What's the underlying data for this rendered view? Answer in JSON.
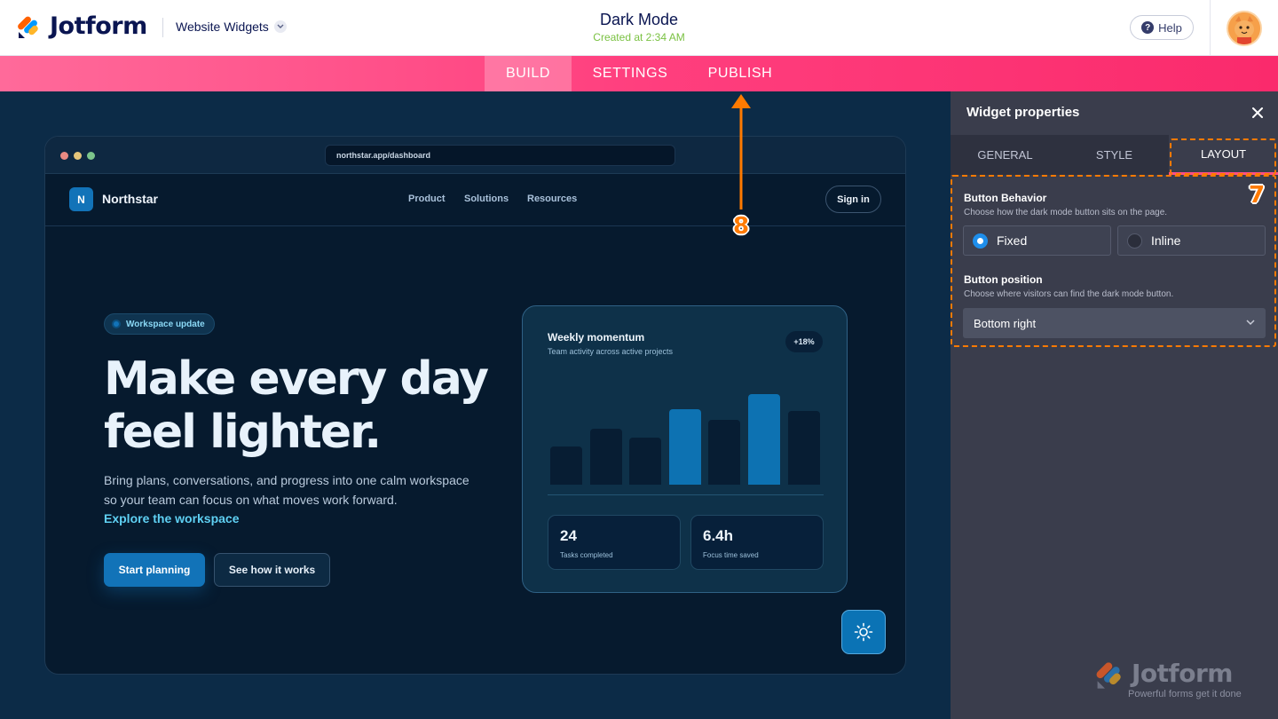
{
  "header": {
    "logo_text": "Jotform",
    "workspace_dropdown": "Website Widgets",
    "doc_title": "Dark Mode",
    "doc_subtitle": "Created at 2:34 AM",
    "help_label": "Help"
  },
  "nav": {
    "tabs": [
      {
        "label": "BUILD",
        "active": true
      },
      {
        "label": "SETTINGS",
        "active": false
      },
      {
        "label": "PUBLISH",
        "active": false
      }
    ]
  },
  "preview": {
    "url": "northstar.app/dashboard",
    "brand": "Northstar",
    "brand_initial": "N",
    "nav_links": [
      "Product",
      "Solutions",
      "Resources"
    ],
    "signin_label": "Sign in",
    "pill_label": "Workspace update",
    "hero_title_line1": "Make every day",
    "hero_title_line2": "feel lighter.",
    "hero_desc_line1": "Bring plans, conversations, and progress into one calm workspace",
    "hero_desc_line2": "so your team can focus on what moves work forward.",
    "hero_link": "Explore the workspace",
    "primary_cta": "Start planning",
    "secondary_cta": "See how it works",
    "card": {
      "title": "Weekly momentum",
      "subtitle": "Team activity across active projects",
      "badge": "+18%",
      "stats": [
        {
          "value": "24",
          "label": "Tasks completed"
        },
        {
          "value": "6.4h",
          "label": "Focus time saved"
        }
      ]
    },
    "theme_toggle_icon": "sun-icon"
  },
  "chart_data": {
    "type": "bar",
    "values": [
      0.42,
      0.62,
      0.52,
      0.83,
      0.72,
      1.0,
      0.81
    ],
    "highlighted": [
      false,
      false,
      false,
      true,
      false,
      true,
      false
    ]
  },
  "annotations": {
    "publish_marker": "8",
    "layout_marker": "7"
  },
  "panel": {
    "title": "Widget properties",
    "tabs": [
      {
        "label": "GENERAL",
        "active": false
      },
      {
        "label": "STYLE",
        "active": false
      },
      {
        "label": "LAYOUT",
        "active": true
      }
    ],
    "button_behavior": {
      "title": "Button Behavior",
      "subtitle": "Choose how the dark mode button sits on the page.",
      "options": [
        {
          "label": "Fixed",
          "selected": true
        },
        {
          "label": "Inline",
          "selected": false
        }
      ]
    },
    "button_position": {
      "title": "Button position",
      "subtitle": "Choose where visitors can find the dark mode button.",
      "selected": "Bottom right"
    },
    "watermark_text": "Jotform",
    "watermark_tagline": "Powerful forms get it done"
  },
  "colors": {
    "brand_pink": "#ff3f7e",
    "accent_blue": "#1273b8",
    "annotation_orange": "#ff7a00",
    "panel_bg": "#3a3d4c"
  }
}
